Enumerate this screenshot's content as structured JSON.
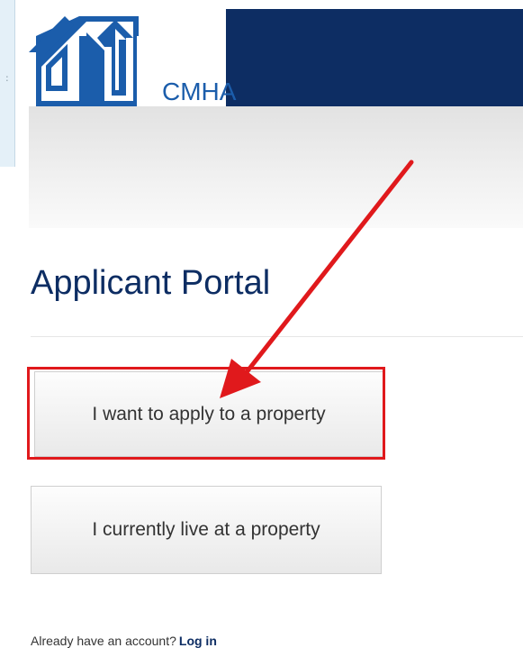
{
  "side_panel": {
    "mark": ":"
  },
  "header": {
    "logo_text": "CMHA",
    "logo_icon": "house-logo-icon",
    "colors": {
      "bar": "#0d2d63",
      "logo_blue": "#1b5dab"
    }
  },
  "main": {
    "title": "Applicant Portal",
    "buttons": {
      "apply": "I want to apply to a property",
      "live": "I currently live at a property"
    },
    "login": {
      "prompt": "Already have an account?",
      "link": "Log in"
    }
  },
  "annotation": {
    "color": "#e0191c",
    "arrow_icon": "red-arrow-annotation"
  }
}
